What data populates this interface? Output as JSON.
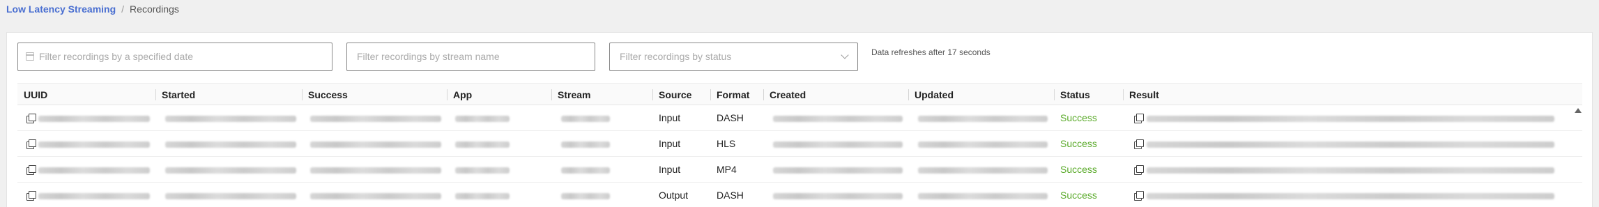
{
  "breadcrumb": {
    "root": "Low Latency Streaming",
    "separator": "/",
    "current": "Recordings"
  },
  "filters": {
    "date_placeholder": "Filter recordings by a specified date",
    "stream_placeholder": "Filter recordings by stream name",
    "status_placeholder": "Filter recordings by status",
    "refresh_note": "Data refreshes after 17 seconds"
  },
  "table": {
    "columns": [
      "UUID",
      "Started",
      "Success",
      "App",
      "Stream",
      "Source",
      "Format",
      "Created",
      "Updated",
      "Status",
      "Result"
    ],
    "rows": [
      {
        "source": "Input",
        "format": "DASH",
        "status": "Success"
      },
      {
        "source": "Input",
        "format": "HLS",
        "status": "Success"
      },
      {
        "source": "Input",
        "format": "MP4",
        "status": "Success"
      },
      {
        "source": "Output",
        "format": "DASH",
        "status": "Success"
      }
    ]
  },
  "colors": {
    "accent_link": "#4a6fd1",
    "status_success": "#5aaa2a"
  },
  "icons": {
    "date_input": "calendar-icon",
    "status_select": "chevron-down-icon",
    "uuid_copy": "copy-icon",
    "result_copy": "copy-icon",
    "scroll": "scroll-up-arrow-icon"
  }
}
